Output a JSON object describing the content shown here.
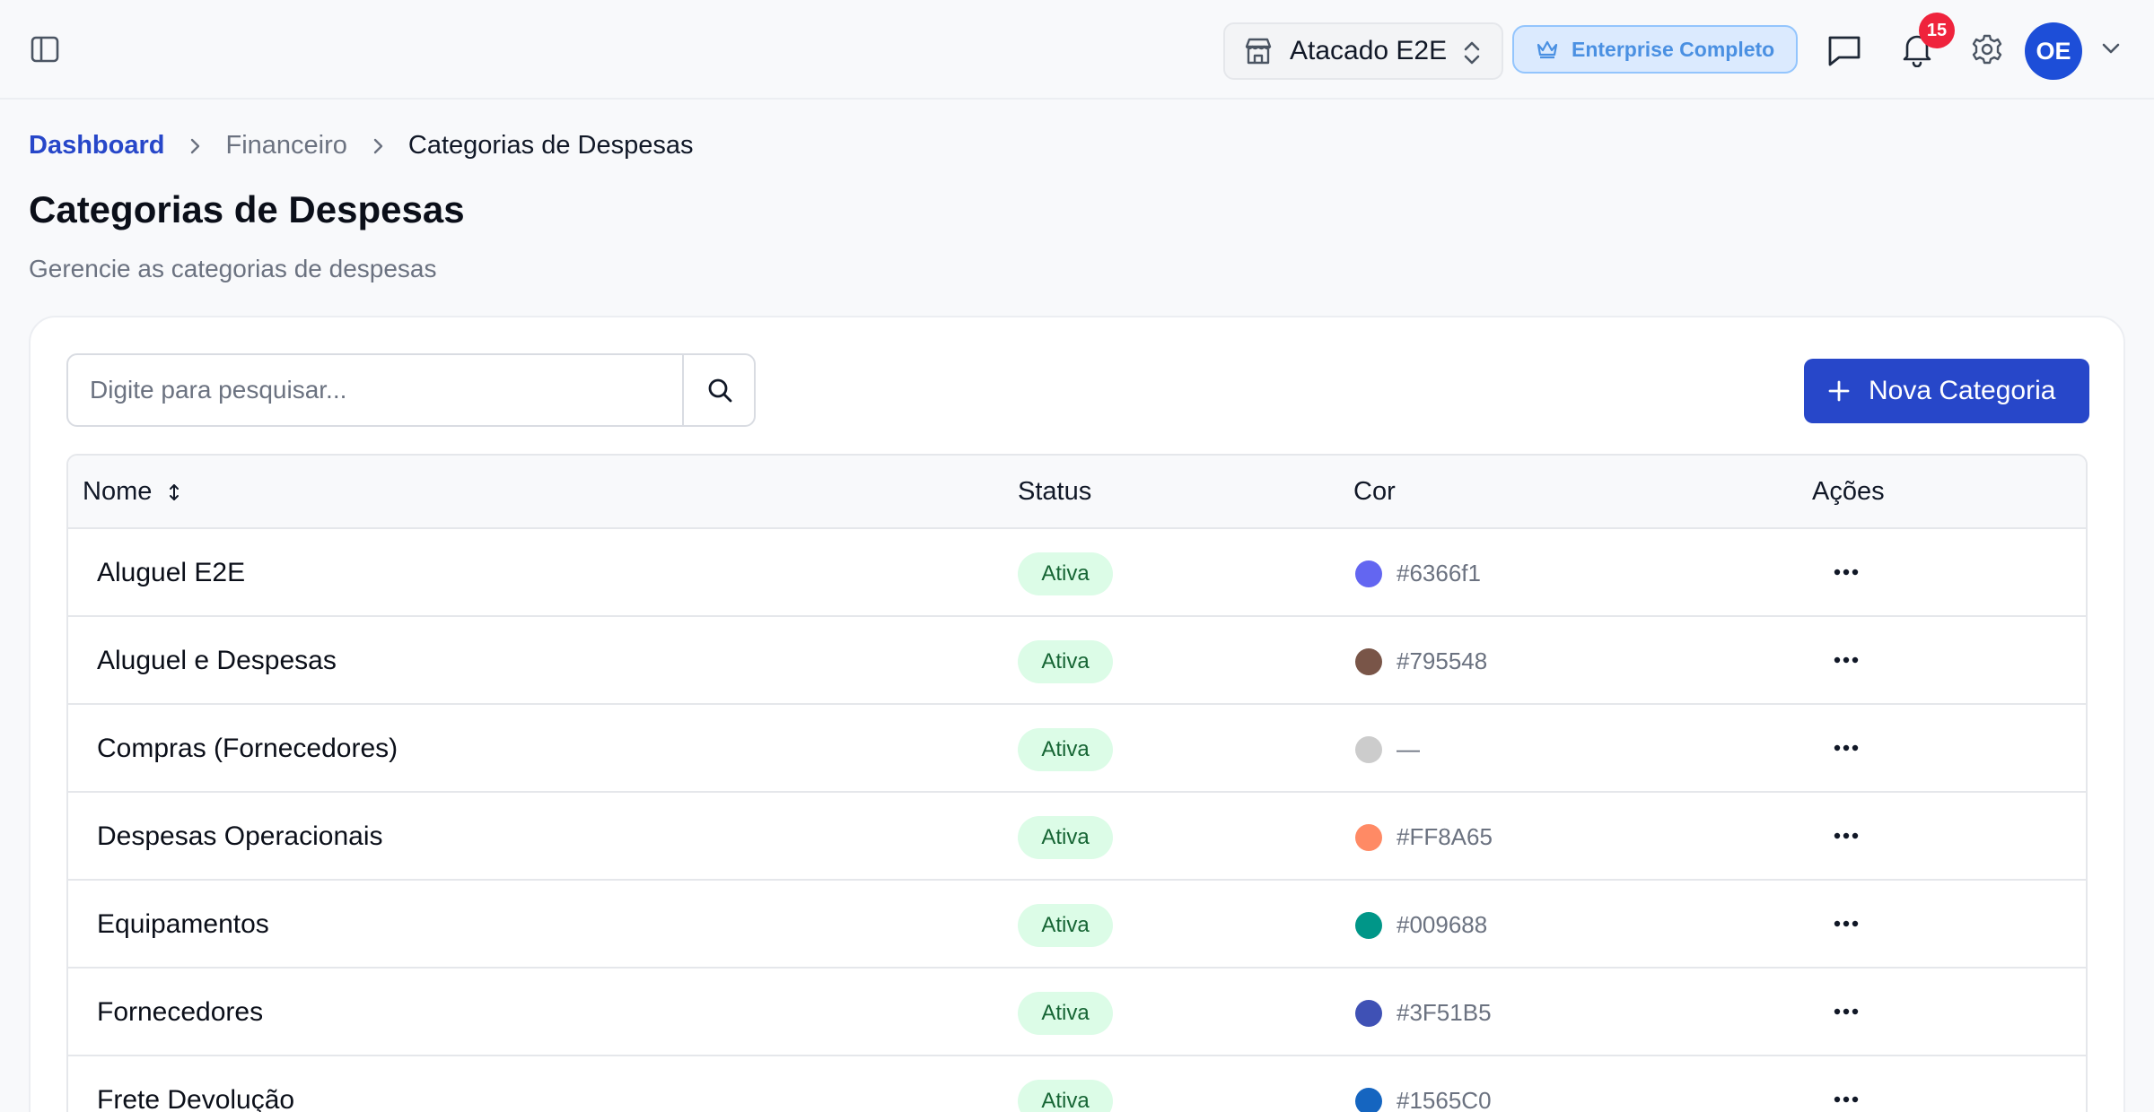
{
  "header": {
    "store": {
      "name": "Atacado E2E"
    },
    "plan": {
      "label": "Enterprise Completo"
    },
    "notifications": {
      "count": "15"
    },
    "user": {
      "initials": "OE"
    }
  },
  "breadcrumb": {
    "items": [
      "Dashboard",
      "Financeiro",
      "Categorias de Despesas"
    ]
  },
  "page": {
    "title": "Categorias de Despesas",
    "subtitle": "Gerencie as categorias de despesas"
  },
  "toolbar": {
    "search_placeholder": "Digite para pesquisar...",
    "new_label": "Nova Categoria"
  },
  "table": {
    "columns": [
      "Nome",
      "Status",
      "Cor",
      "Ações"
    ],
    "rows": [
      {
        "name": "Aluguel E2E",
        "status": "Ativa",
        "color": "#6366f1",
        "color_label": "#6366f1"
      },
      {
        "name": "Aluguel e Despesas",
        "status": "Ativa",
        "color": "#795548",
        "color_label": "#795548"
      },
      {
        "name": "Compras (Fornecedores)",
        "status": "Ativa",
        "color": "#cccccc",
        "color_label": "—"
      },
      {
        "name": "Despesas Operacionais",
        "status": "Ativa",
        "color": "#FF8A65",
        "color_label": "#FF8A65"
      },
      {
        "name": "Equipamentos",
        "status": "Ativa",
        "color": "#009688",
        "color_label": "#009688"
      },
      {
        "name": "Fornecedores",
        "status": "Ativa",
        "color": "#3F51B5",
        "color_label": "#3F51B5"
      },
      {
        "name": "Frete Devolução",
        "status": "Ativa",
        "color": "#1565C0",
        "color_label": "#1565C0"
      }
    ]
  },
  "theme": {
    "primary": "#2747c9",
    "status_bg": "#dcfce7",
    "status_text": "#166534",
    "notification": "#ef233c"
  },
  "icons": {
    "sidebar": "sidebar-toggle-icon",
    "store": "store-icon",
    "plan": "crown-icon",
    "chat": "chat-icon",
    "bell": "bell-icon",
    "settings": "gear-icon",
    "search": "search-icon",
    "add": "plus-icon",
    "more": "more-horizontal-icon"
  }
}
